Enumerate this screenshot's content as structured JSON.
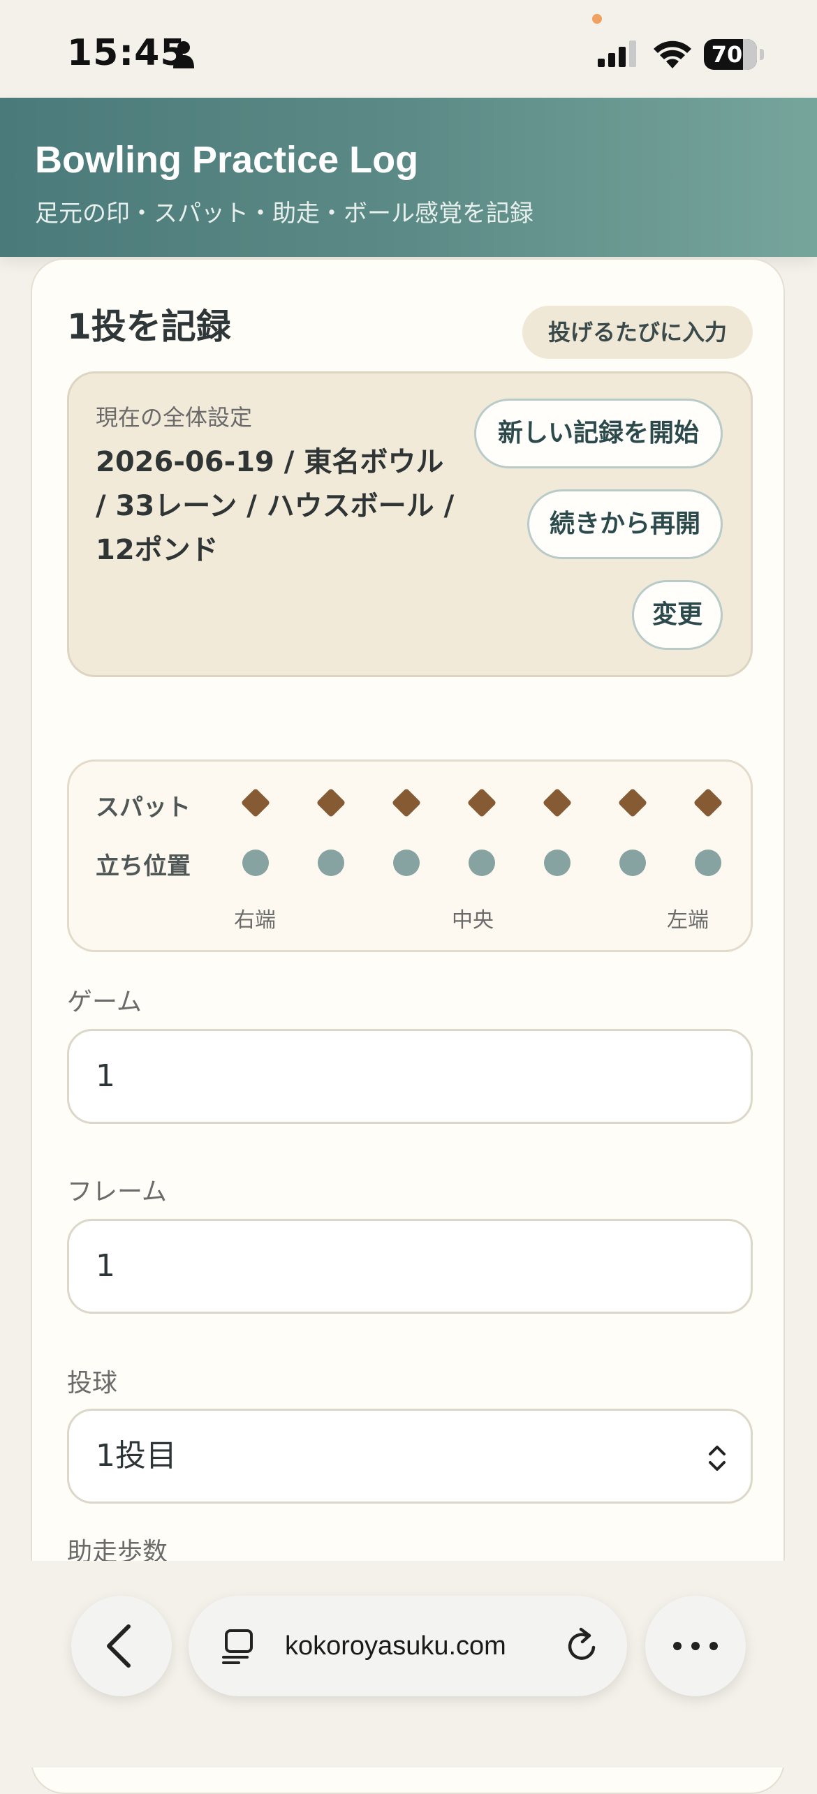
{
  "status": {
    "time": "15:45",
    "battery": "70"
  },
  "header": {
    "title": "Bowling Practice Log",
    "subtitle": "足元の印・スパット・助走・ボール感覚を記録"
  },
  "card": {
    "title": "1投を記録",
    "hint": "投げるたびに入力",
    "settings": {
      "label": "現在の全体設定",
      "value": "2026-06-19 / 東名ボウル / 33レーン / ハウスボール / 12ポンド",
      "new_button": "新しい記録を開始",
      "resume_button": "続きから再開",
      "change_button": "変更"
    },
    "lane": {
      "spot_label": "スパット",
      "stand_label": "立ち位置",
      "caption_right": "右端",
      "caption_center": "中央",
      "caption_left": "左端"
    },
    "fields": {
      "game_label": "ゲーム",
      "game_value": "1",
      "frame_label": "フレーム",
      "frame_value": "1",
      "throw_label": "投球",
      "throw_value": "1投目",
      "steps_label": "助走歩数"
    }
  },
  "browser": {
    "url": "kokoroyasuku.com"
  }
}
